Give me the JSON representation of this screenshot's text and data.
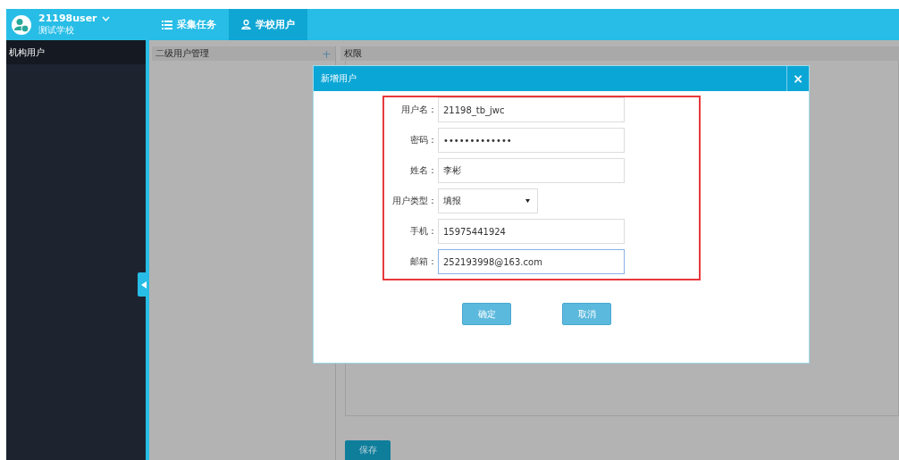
{
  "user": {
    "name": "21198user",
    "school": "测试学校"
  },
  "nav": [
    {
      "label": "采集任务",
      "kind": "list",
      "selected": false
    },
    {
      "label": "学校用户",
      "kind": "user",
      "selected": true
    }
  ],
  "sidebar": {
    "title": "机构用户"
  },
  "left_panel": {
    "title": "二级用户管理",
    "add": "+"
  },
  "right_panel": {
    "title": "权限",
    "save": "保存"
  },
  "dialog": {
    "title": "新增用户",
    "close": "×",
    "fields": [
      {
        "kind": "text",
        "label": "用户名：",
        "value": "21198_tb_jwc",
        "focused": false
      },
      {
        "kind": "text",
        "label": "密码：",
        "value": "•••••••••••••",
        "focused": false
      },
      {
        "kind": "text",
        "label": "姓名：",
        "value": "李彬",
        "focused": false
      },
      {
        "kind": "select",
        "label": "用户类型：",
        "value": "填报",
        "focused": false
      },
      {
        "kind": "text",
        "label": "手机：",
        "value": "15975441924",
        "focused": false
      },
      {
        "kind": "text",
        "label": "邮箱：",
        "value": "252193998@163.com",
        "focused": true
      }
    ],
    "buttons": [
      "确定",
      "取消"
    ]
  }
}
